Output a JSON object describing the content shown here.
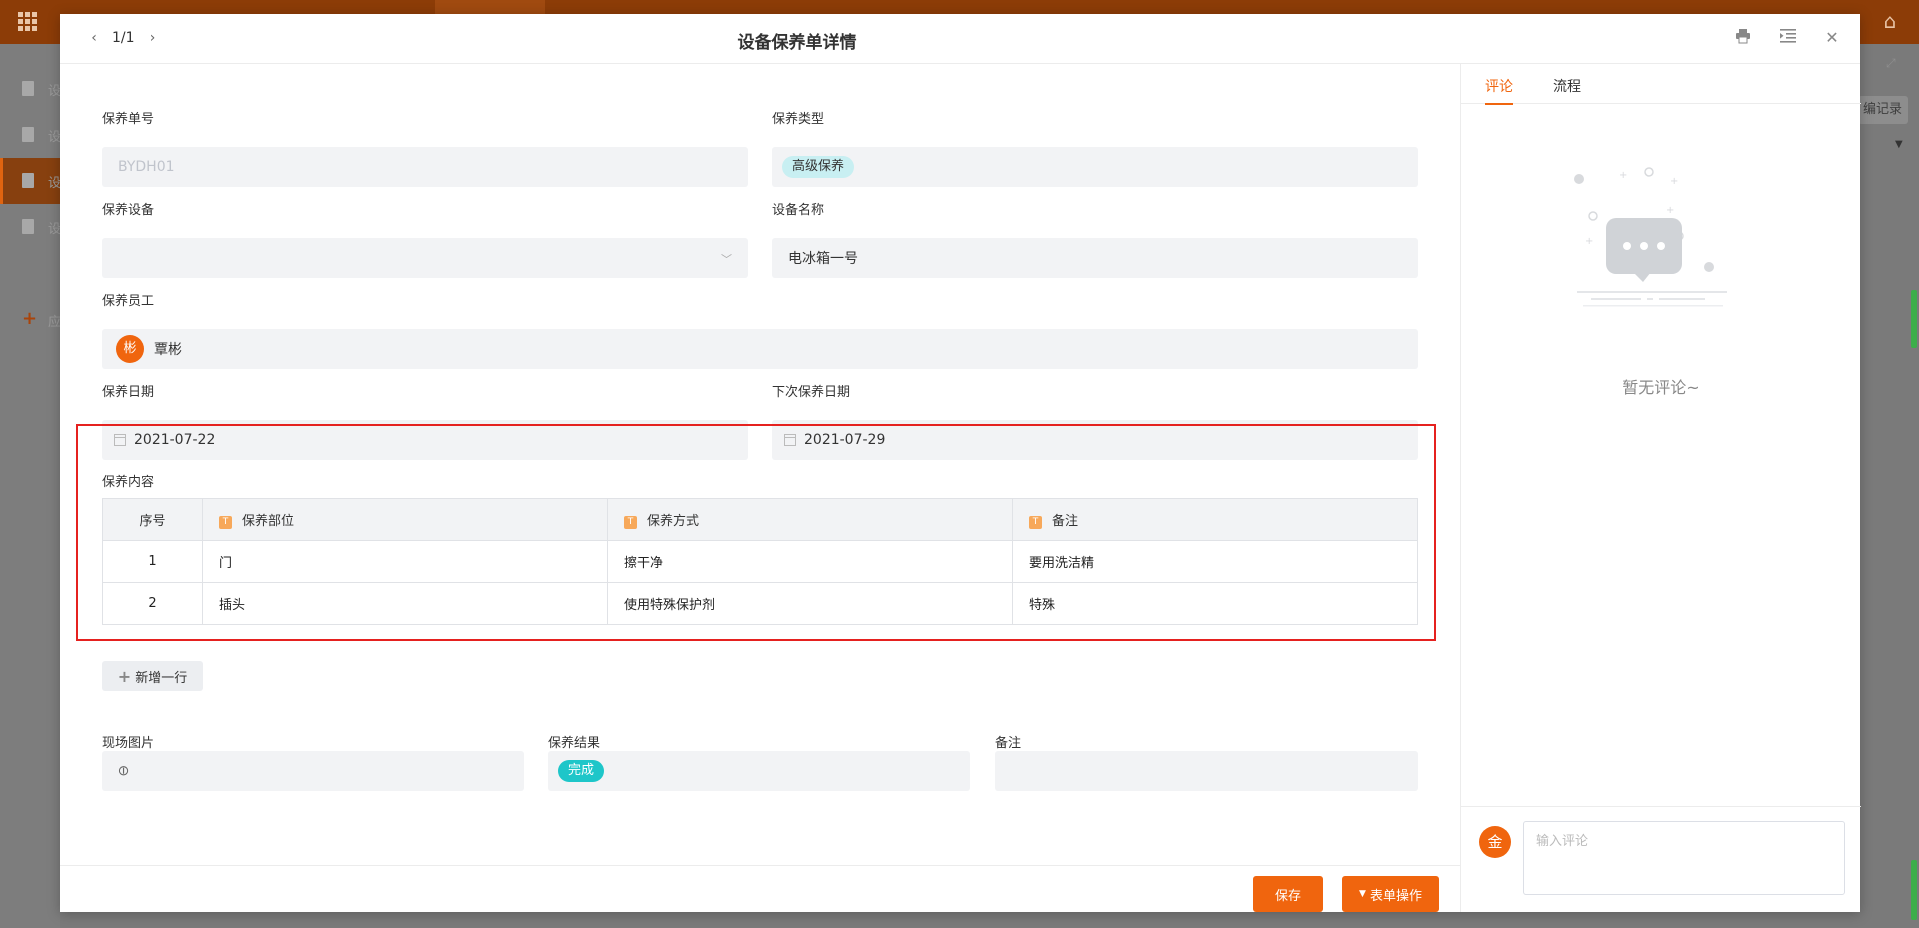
{
  "background": {
    "sidebar_items": [
      "设",
      "设",
      "设",
      "设"
    ],
    "sidebar_add_label": "应",
    "right_button_label": "编记录"
  },
  "modal": {
    "pager": "1/1",
    "title": "设备保养单详情",
    "icons": [
      "print-icon",
      "indent-icon",
      "close-icon"
    ]
  },
  "form": {
    "order_no": {
      "label": "保养单号",
      "value": "BYDH01"
    },
    "type": {
      "label": "保养类型",
      "value": "高级保养"
    },
    "equipment": {
      "label": "保养设备",
      "value": ""
    },
    "equipment_name": {
      "label": "设备名称",
      "value": "电冰箱一号"
    },
    "staff": {
      "label": "保养员工",
      "avatar": "彬",
      "name": "覃彬"
    },
    "date": {
      "label": "保养日期",
      "value": "2021-07-22"
    },
    "next_date": {
      "label": "下次保养日期",
      "value": "2021-07-29"
    },
    "content": {
      "label": "保养内容",
      "columns": [
        "序号",
        "保养部位",
        "保养方式",
        "备注"
      ],
      "rows": [
        {
          "no": "1",
          "part": "门",
          "method": "擦干净",
          "note": "要用洗洁精"
        },
        {
          "no": "2",
          "part": "插头",
          "method": "使用特殊保护剂",
          "note": "特殊"
        }
      ],
      "add_row": "新增一行"
    },
    "photo": {
      "label": "现场图片"
    },
    "result": {
      "label": "保养结果",
      "value": "完成"
    },
    "remark": {
      "label": "备注",
      "value": ""
    }
  },
  "footer": {
    "save": "保存",
    "actions": "表单操作"
  },
  "side": {
    "tabs": [
      "评论",
      "流程"
    ],
    "active_tab": "评论",
    "empty_text": "暂无评论~",
    "avatar": "金",
    "comment_placeholder": "输入评论"
  },
  "colors": {
    "accent": "#f0650e",
    "highlight_border": "#e5211f",
    "tag_done": "#1ec6c9",
    "tag_advanced": "#c8eff2"
  }
}
